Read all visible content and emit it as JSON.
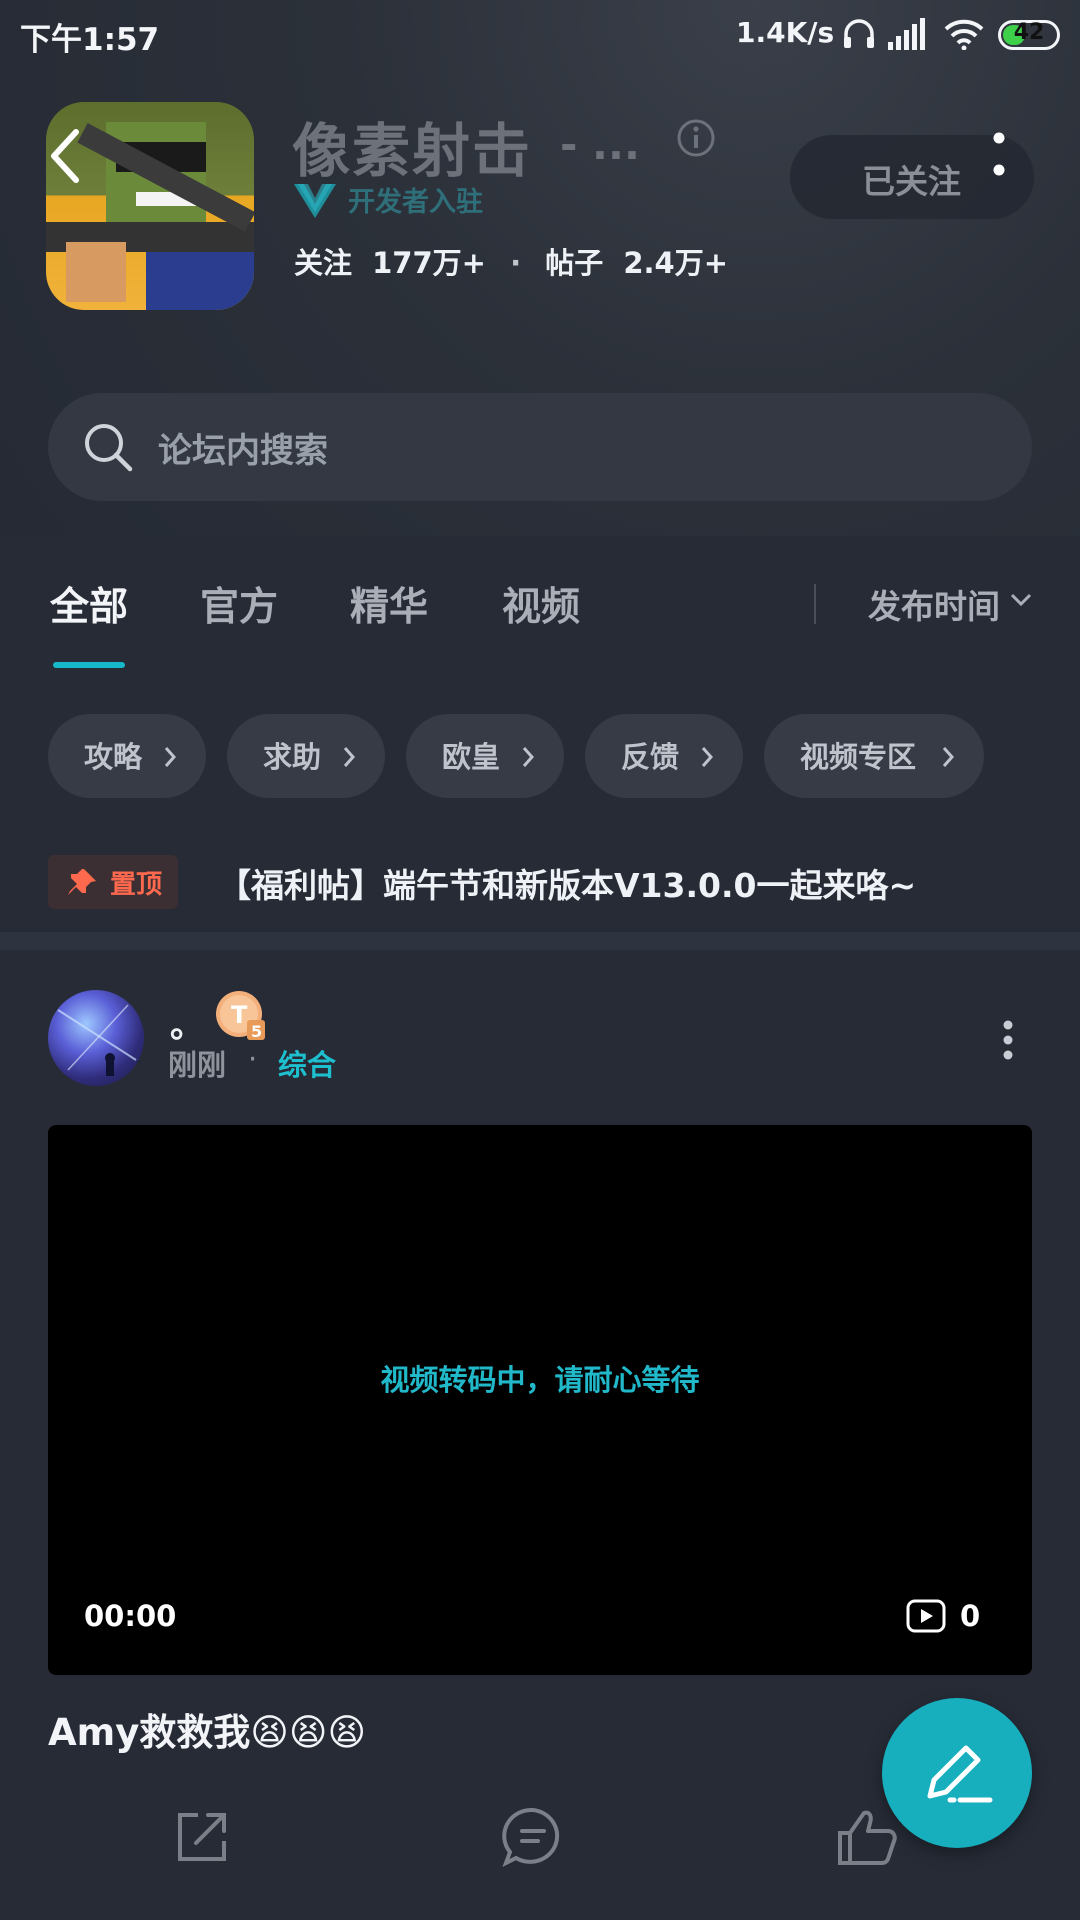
{
  "status_bar": {
    "time": "下午1:57",
    "net_speed": "1.4K/s",
    "battery": "42",
    "battery_level_percent": 42
  },
  "header": {
    "title": "像素射击",
    "title_suffix": "- ...",
    "developer_badge": "开发者入驻",
    "followers_label": "关注",
    "followers_value": "177万+",
    "separator": "·",
    "posts_label": "帖子",
    "posts_value": "2.4万+",
    "follow_button": "已关注"
  },
  "search": {
    "placeholder": "论坛内搜索"
  },
  "tabs": {
    "items": [
      "全部",
      "官方",
      "精华",
      "视频"
    ],
    "active_index": 0,
    "sort_label": "发布时间"
  },
  "chips": [
    "攻略",
    "求助",
    "欧皇",
    "反馈",
    "视频专区"
  ],
  "pinned": {
    "badge": "置顶",
    "title": "【福利帖】端午节和新版本V13.0.0一起来咯~"
  },
  "post": {
    "username": "。",
    "level_badge": "T5",
    "time": "刚刚",
    "dot": "·",
    "category": "综合",
    "video_message": "视频转码中，请耐心等待",
    "video_duration": "00:00",
    "video_plays": "0",
    "text": "Amy救救我😫😫😫"
  },
  "colors": {
    "accent": "#17b8c9",
    "background": "#262b36",
    "pin_red": "#ff6a4f"
  },
  "icons": [
    "back-icon",
    "info-icon",
    "more-vertical-icon",
    "search-icon",
    "chevron-down-icon",
    "chevron-right-icon",
    "pin-icon",
    "play-count-icon",
    "share-icon",
    "comment-icon",
    "like-icon",
    "edit-pen-icon",
    "headphones-icon",
    "signal-icon",
    "wifi-icon",
    "battery-icon"
  ]
}
